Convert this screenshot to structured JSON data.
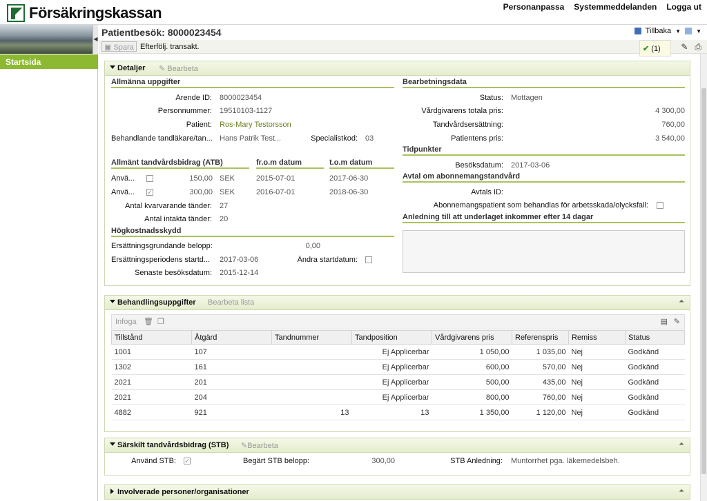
{
  "top": {
    "logo_text": "Försäkringskassan",
    "links": [
      "Personanpassa",
      "Systemmeddelanden",
      "Logga ut"
    ]
  },
  "sidebar": {
    "item": "Startsida"
  },
  "header": {
    "title": "Patientbesök: 8000023454",
    "back_label": "Tillbaka"
  },
  "toolbar": {
    "save_label": "Spara",
    "followup_label": "Efterfölj. transakt.",
    "status_count": "(1)"
  },
  "detaljer": {
    "title": "Detaljer",
    "edit_label": "Bearbeta",
    "general": {
      "heading": "Allmänna uppgifter",
      "arende_label": "Ärende ID:",
      "arende_value": "8000023454",
      "pnr_label": "Personnummer:",
      "pnr_value": "19510103-1127",
      "patient_label": "Patient:",
      "patient_value": "Ros-Mary Testorsson",
      "dentist_label": "Behandlande tandläkare/tan...",
      "dentist_value": "Hans Patrik Test...",
      "spec_label": "Specialistkod:",
      "spec_value": "03"
    },
    "atb": {
      "heading": "Allmänt tandvårdsbidrag (ATB)",
      "from_heading": "fr.o.m datum",
      "tom_heading": "t.o.m datum",
      "rows": [
        {
          "label": "Anvä...",
          "amount": "150,00",
          "currency": "SEK",
          "from": "2015-07-01",
          "tom": "2017-06-30"
        },
        {
          "label": "Anvä...",
          "amount": "300,00",
          "currency": "SEK",
          "from": "2016-07-01",
          "tom": "2018-06-30"
        }
      ],
      "remaining_label": "Antal kvarvarande tänder:",
      "remaining_value": "27",
      "intact_label": "Antal intakta tänder:",
      "intact_value": "20"
    },
    "hks": {
      "heading": "Högkostnadsskydd",
      "basis_label": "Ersättningsgrundande belopp:",
      "basis_value": "0,00",
      "start_label": "Ersättningsperiodens startd...",
      "start_value": "2017-03-06",
      "change_label": "Ändra startdatum:",
      "last_label": "Senaste besöksdatum:",
      "last_value": "2015-12-14"
    },
    "processing": {
      "heading": "Bearbetningsdata",
      "status_label": "Status:",
      "status_value": "Mottagen",
      "total_label": "Vårdgivarens totala pris:",
      "total_value": "4 300,00",
      "comp_label": "Tandvårdsersättning:",
      "comp_value": "760,00",
      "patient_label": "Patientens pris:",
      "patient_value": "3 540,00"
    },
    "timepoints": {
      "heading": "Tidpunkter",
      "visit_label": "Besöksdatum:",
      "visit_value": "2017-03-06"
    },
    "subscription": {
      "heading": "Avtal om abonnemangstandvård",
      "id_label": "Avtals ID:",
      "patient_label": "Abonnemangspatient som behandlas för arbetsskada/olycksfall:"
    },
    "reason": {
      "heading": "Anledning till att underlaget inkommer efter 14 dagar"
    }
  },
  "behandling": {
    "title": "Behandlingsuppgifter",
    "edit_label": "Bearbeta lista",
    "insert_label": "Infoga",
    "columns": [
      "Tillstånd",
      "Åtgärd",
      "Tandnummer",
      "Tandposition",
      "Vårdgivarens pris",
      "Referenspris",
      "Remiss",
      "Status"
    ],
    "rows": [
      [
        "1001",
        "107",
        "",
        "Ej Applicerbar",
        "1 050,00",
        "1 035,00",
        "Nej",
        "Godkänd"
      ],
      [
        "1302",
        "161",
        "",
        "Ej Applicerbar",
        "600,00",
        "570,00",
        "Nej",
        "Godkänd"
      ],
      [
        "2021",
        "201",
        "",
        "Ej Applicerbar",
        "500,00",
        "435,00",
        "Nej",
        "Godkänd"
      ],
      [
        "2021",
        "204",
        "",
        "Ej Applicerbar",
        "800,00",
        "760,00",
        "Nej",
        "Godkänd"
      ],
      [
        "4882",
        "921",
        "13",
        "13",
        "1 350,00",
        "1 120,00",
        "Nej",
        "Godkänd"
      ]
    ]
  },
  "stb": {
    "title": "Särskilt tandvårdsbidrag (STB)",
    "edit_label": "Bearbeta",
    "use_label": "Använd STB:",
    "amount_label": "Begärt STB belopp:",
    "amount_value": "300,00",
    "reason_label": "STB Anledning:",
    "reason_value": "Muntorrhet pga. läkemedelsbeh."
  },
  "involved": {
    "title": "Involverade personer/organisationer"
  },
  "colors": {
    "accent": "#8db832",
    "brand": "#1e6b32"
  }
}
